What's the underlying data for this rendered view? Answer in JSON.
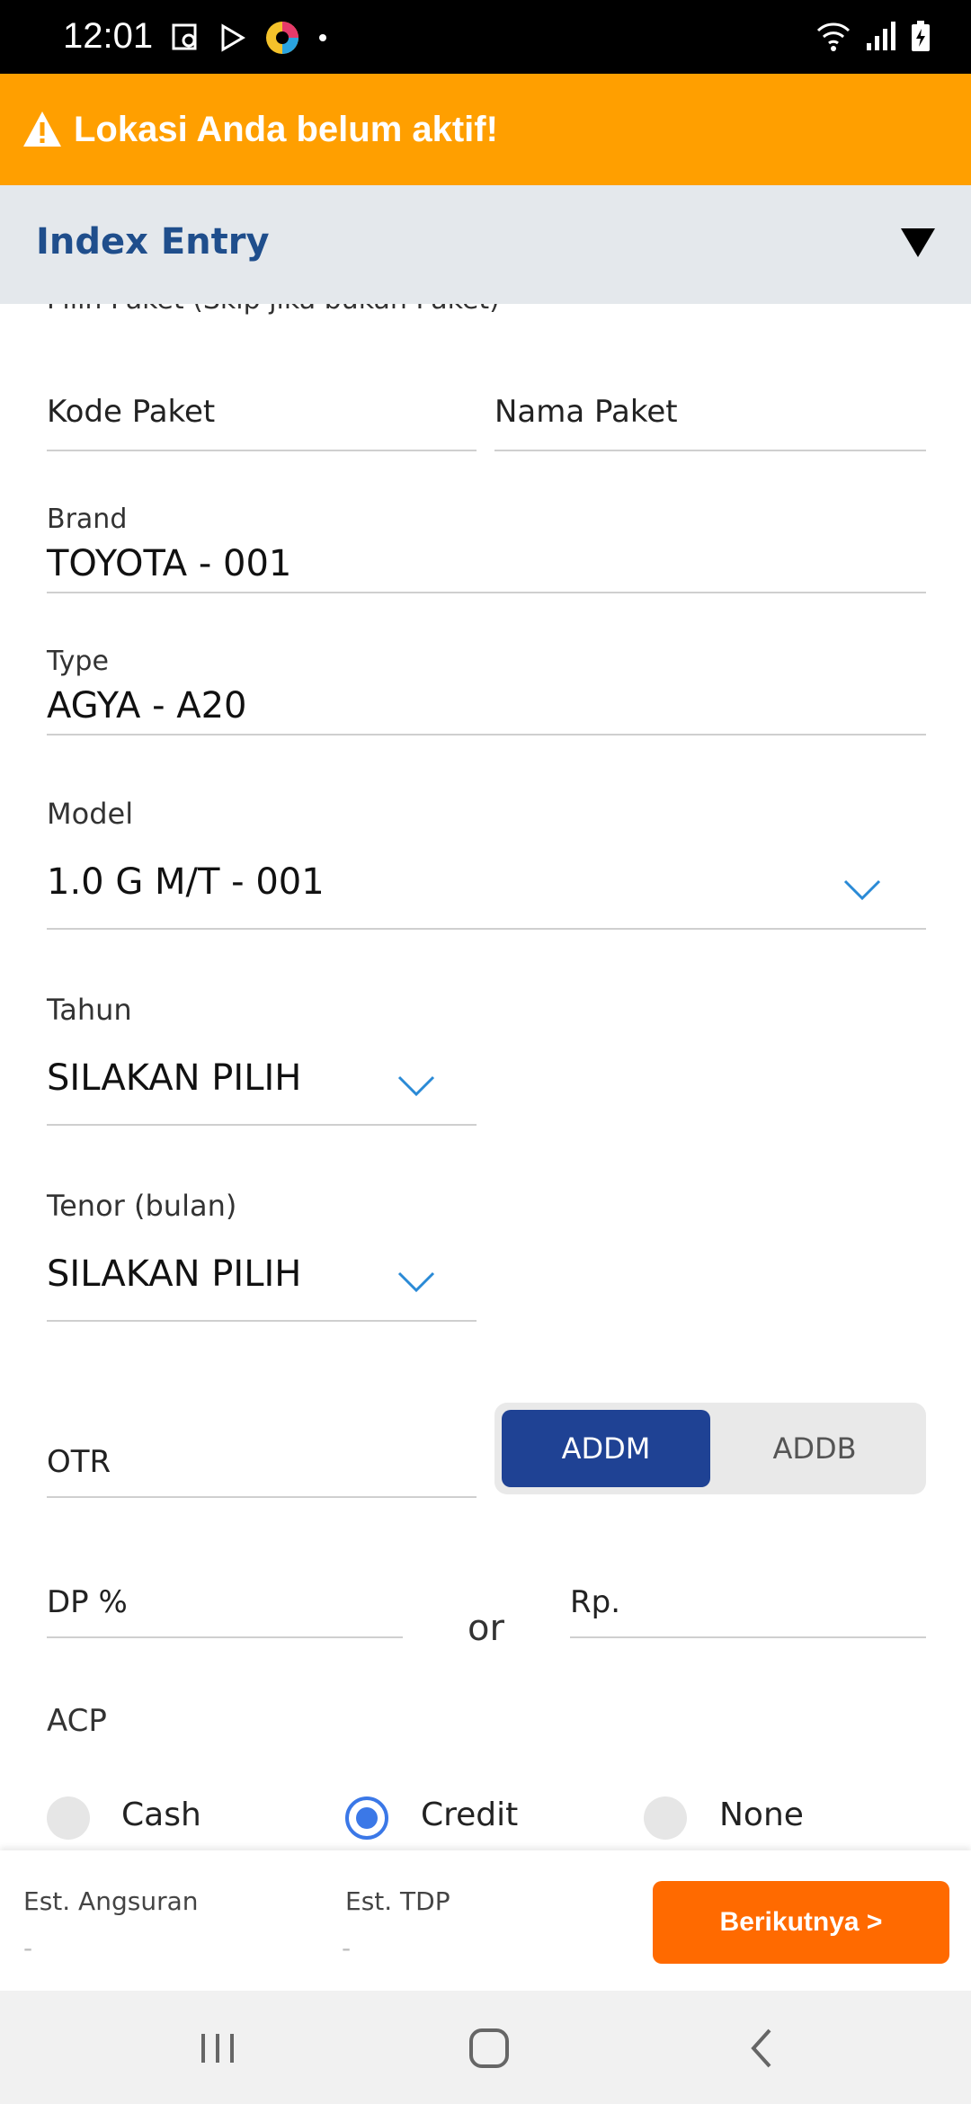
{
  "status_bar": {
    "time": "12:01"
  },
  "warning": {
    "text": "Lokasi Anda belum aktif!"
  },
  "header": {
    "title": "Index Entry"
  },
  "form": {
    "paket_label": "Pilih Paket (Skip jika bukan Paket)",
    "kode_paket_placeholder": "Kode Paket",
    "nama_paket_placeholder": "Nama Paket",
    "brand_label": "Brand",
    "brand_value": "TOYOTA - 001",
    "type_label": "Type",
    "type_value": "AGYA - A20",
    "model_label": "Model",
    "model_value": "1.0 G M/T - 001",
    "tahun_label": "Tahun",
    "tahun_value": "SILAKAN PILIH",
    "tenor_label": "Tenor (bulan)",
    "tenor_value": "SILAKAN PILIH",
    "otr_placeholder": "OTR",
    "segment": {
      "options": [
        "ADDM",
        "ADDB"
      ],
      "selected": "ADDM"
    },
    "dp_percent_placeholder": "DP %",
    "or_text": "or",
    "rp_placeholder": "Rp.",
    "acp_label": "ACP",
    "acp_options": [
      "Cash",
      "Credit",
      "None"
    ],
    "acp_selected": "Credit"
  },
  "bottom_bar": {
    "est_angsuran_label": "Est. Angsuran",
    "est_angsuran_value": "-",
    "est_tdp_label": "Est. TDP",
    "est_tdp_value": "-",
    "next_button": "Berikutnya >"
  },
  "colors": {
    "warning": "#ff9f00",
    "header_bg": "#e4e8ec",
    "title": "#1f4e8c",
    "segment_active": "#1f4294",
    "next_button": "#ff6a00",
    "radio_selected": "#3b78e7"
  }
}
